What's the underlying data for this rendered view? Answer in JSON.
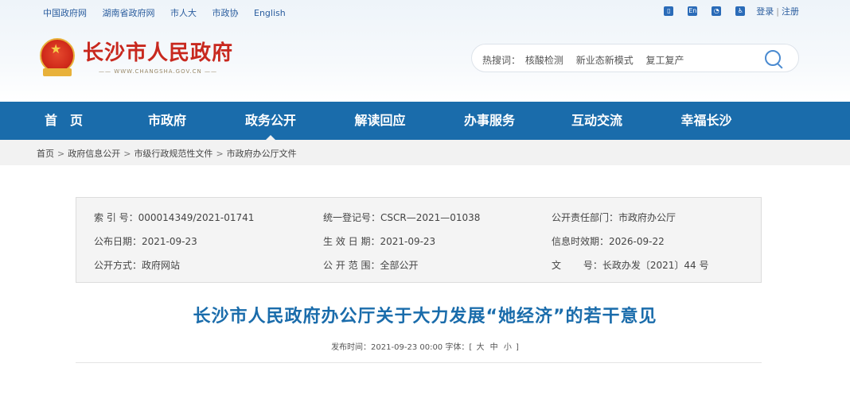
{
  "top_links": [
    "中国政府网",
    "湖南省政府网",
    "市人大",
    "市政协",
    "English"
  ],
  "utility": {
    "login": "登录",
    "separator": "|",
    "register": "注册",
    "en_icon_text": "En"
  },
  "site": {
    "title": "长沙市人民政府",
    "domain": "WWW.CHANGSHA.GOV.CN"
  },
  "search": {
    "hot_label": "热搜词：",
    "hot_words": [
      "核酸检测",
      "新业态新模式",
      "复工复产"
    ],
    "icon": "search-icon"
  },
  "nav": [
    {
      "label": "首　页",
      "active": false
    },
    {
      "label": "市政府",
      "active": false
    },
    {
      "label": "政务公开",
      "active": true
    },
    {
      "label": "解读回应",
      "active": false
    },
    {
      "label": "办事服务",
      "active": false
    },
    {
      "label": "互动交流",
      "active": false
    },
    {
      "label": "幸福长沙",
      "active": false
    }
  ],
  "breadcrumb": [
    "首页",
    "政府信息公开",
    "市级行政规范性文件",
    "市政府办公厅文件"
  ],
  "info": {
    "index_no": "索 引 号：000014349/2021-01741",
    "reg_no": "统一登记号：CSCR—2021—01038",
    "dept": "公开责任部门：市政府办公厅",
    "pub_date": "公布日期：2021-09-23",
    "effective_date": "生 效 日 期：2021-09-23",
    "expire_date": "信息时效期：2026-09-22",
    "method": "公开方式：政府网站",
    "scope": "公 开 范 围：全部公开",
    "doc_no": "文　　 号：长政办发〔2021〕44 号"
  },
  "article": {
    "title": "长沙市人民政府办公厅关于大力发展“她经济”的若干意见",
    "meta_prefix": "发布时间：2021-09-23 00:00  字体：[",
    "font_sizes": [
      "大",
      "中",
      "小"
    ],
    "meta_suffix": "]"
  },
  "colors": {
    "nav_bg": "#1a6cab",
    "title": "#1a6cab",
    "logo": "#c8281e"
  }
}
